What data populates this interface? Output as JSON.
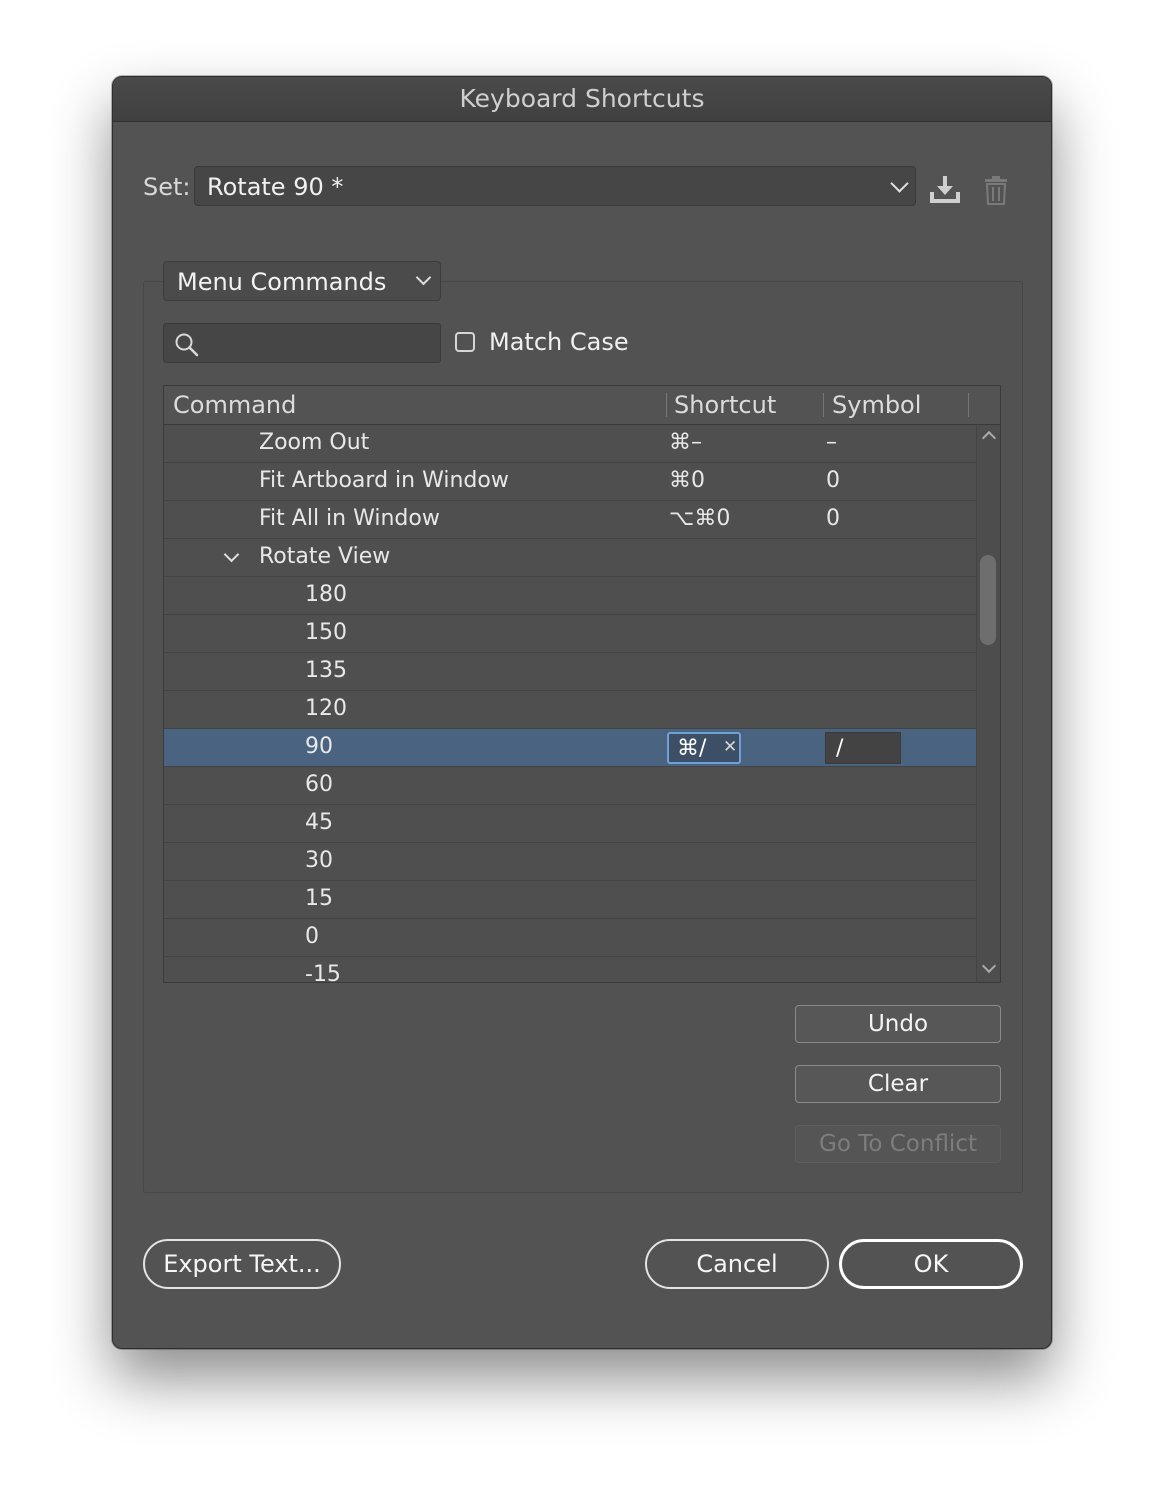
{
  "window": {
    "title": "Keyboard Shortcuts"
  },
  "set": {
    "label": "Set:",
    "value": "Rotate 90 *"
  },
  "mode": {
    "value": "Menu Commands"
  },
  "search": {
    "placeholder": ""
  },
  "match_case": {
    "label": "Match Case",
    "checked": false
  },
  "table": {
    "headers": {
      "command": "Command",
      "shortcut": "Shortcut",
      "symbol": "Symbol"
    },
    "rows": [
      {
        "command": "Zoom Out",
        "indent": 1,
        "shortcut": "⌘–",
        "symbol": "–"
      },
      {
        "command": "Fit Artboard in Window",
        "indent": 1,
        "shortcut": "⌘0",
        "symbol": "0"
      },
      {
        "command": "Fit All in Window",
        "indent": 1,
        "shortcut": "⌥⌘0",
        "symbol": "0"
      },
      {
        "command": "Rotate View",
        "indent": 1,
        "expanded": true,
        "shortcut": "",
        "symbol": ""
      },
      {
        "command": "180",
        "indent": 2,
        "shortcut": "",
        "symbol": ""
      },
      {
        "command": "150",
        "indent": 2,
        "shortcut": "",
        "symbol": ""
      },
      {
        "command": "135",
        "indent": 2,
        "shortcut": "",
        "symbol": ""
      },
      {
        "command": "120",
        "indent": 2,
        "shortcut": "",
        "symbol": ""
      },
      {
        "command": "90",
        "indent": 2,
        "selected": true,
        "shortcut": "⌘/",
        "symbol": "/"
      },
      {
        "command": "60",
        "indent": 2,
        "shortcut": "",
        "symbol": ""
      },
      {
        "command": "45",
        "indent": 2,
        "shortcut": "",
        "symbol": ""
      },
      {
        "command": "30",
        "indent": 2,
        "shortcut": "",
        "symbol": ""
      },
      {
        "command": "15",
        "indent": 2,
        "shortcut": "",
        "symbol": ""
      },
      {
        "command": "0",
        "indent": 2,
        "shortcut": "",
        "symbol": ""
      },
      {
        "command": "-15",
        "indent": 2,
        "shortcut": "",
        "symbol": ""
      }
    ]
  },
  "buttons": {
    "undo": "Undo",
    "clear": "Clear",
    "go_to_conflict": "Go To Conflict",
    "export": "Export Text...",
    "cancel": "Cancel",
    "ok": "OK"
  },
  "icons": {
    "set_dropdown": "chevron-down-icon",
    "save": "save-set-icon",
    "delete": "trash-icon",
    "search": "search-icon",
    "clear_shortcut": "close-icon"
  },
  "colors": {
    "dialog_bg": "#535353",
    "selection": "#4a6380",
    "focus_ring": "#6fa0d8"
  }
}
